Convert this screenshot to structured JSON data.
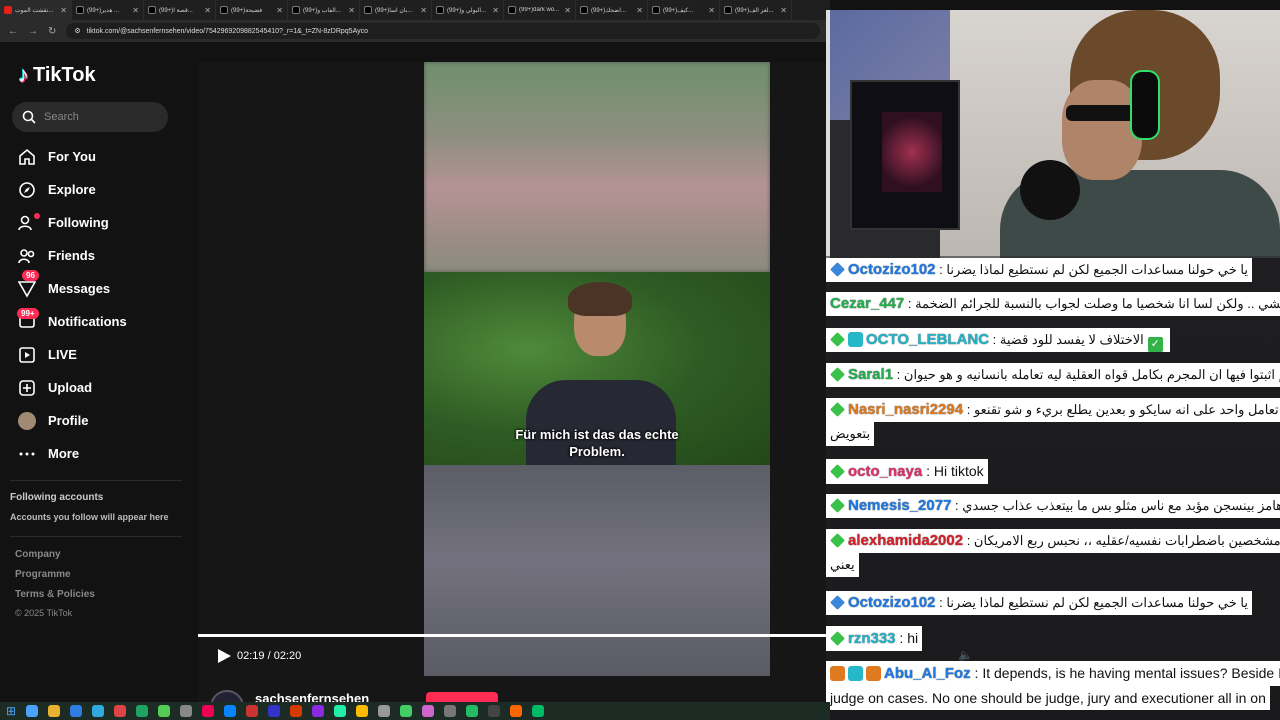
{
  "browser": {
    "tabs": [
      {
        "label": "نقشت الموت...",
        "fav": "youtube-icon",
        "active": true
      },
      {
        "label": "(99+)هدير ...",
        "fav": "tiktok-icon"
      },
      {
        "label": "(99+)قصة ا...",
        "fav": "tiktok-icon"
      },
      {
        "label": "(99+)فضيحة",
        "fav": "tiktok-icon"
      },
      {
        "label": "(99+)الفاب و...",
        "fav": "tiktok-icon"
      },
      {
        "label": "(99+)بان اسا...",
        "fav": "tiktok-icon"
      },
      {
        "label": "(99+)البولي و...",
        "fav": "tiktok-icon"
      },
      {
        "label": "(99+)dark wo...",
        "fav": "tiktok-icon"
      },
      {
        "label": "(99+)اضحك...",
        "fav": "tiktok-icon"
      },
      {
        "label": "(99+)كيف...",
        "fav": "tiktok-icon"
      },
      {
        "label": "(99+)لغز الف...",
        "fav": "tiktok-icon"
      }
    ],
    "url": "tiktok.com/@sachsenfernsehen/video/7542969209882545410?_r=1&_t=ZN-8zDRpq5Ayco"
  },
  "sidebar": {
    "logo": "TikTok",
    "search_placeholder": "Search",
    "nav": [
      {
        "label": "For You",
        "icon": "home-icon"
      },
      {
        "label": "Explore",
        "icon": "compass-icon"
      },
      {
        "label": "Following",
        "icon": "following-icon",
        "dot": true
      },
      {
        "label": "Friends",
        "icon": "friends-icon"
      },
      {
        "label": "Messages",
        "icon": "messages-icon",
        "badge": "96"
      },
      {
        "label": "Notifications",
        "icon": "notifications-icon",
        "badge": "99+"
      },
      {
        "label": "LIVE",
        "icon": "live-icon"
      },
      {
        "label": "Upload",
        "icon": "upload-icon"
      },
      {
        "label": "Profile",
        "icon": "profile-avatar"
      },
      {
        "label": "More",
        "icon": "more-icon"
      }
    ],
    "following_accounts_title": "Following accounts",
    "following_accounts_sub": "Accounts you follow will appear here",
    "footer_links": [
      "Company",
      "Programme",
      "Terms & Policies"
    ],
    "copyright": "© 2025 TikTok"
  },
  "video": {
    "subtitle_line1": "Für mich ist das das echte",
    "subtitle_line2": "Problem.",
    "time": "02:19 / 02:20",
    "progress": 0.993,
    "author": "sachsenfernsehen"
  },
  "chat": [
    {
      "badges": [
        "diamond-blue"
      ],
      "user": "Octozizo102",
      "color": "#1e7be6",
      "text": "يا خي حولنا مساعدات الجميع لكن لم نستطيع لماذا يضرنا",
      "arabic": true
    },
    {
      "badges": [],
      "user": "Cezar_447",
      "color": "#22b14c",
      "text": "معك بهالشي .. ولكن لسا انا شخصيا ما وصلت لجواب بالنسبة للجرائم الضخمة",
      "arabic": true
    },
    {
      "badges": [
        "diamond-green",
        "mod"
      ],
      "user": "OCTO_LEBLANC",
      "color": "#22b5c8",
      "text": "الاختلاف لا يفسد للود قضية",
      "arabic": true,
      "check": true
    },
    {
      "badges": [
        "diamond-green"
      ],
      "user": "Saral1",
      "color": "#22b14c",
      "text": "فيه جرائم اثبتوا فيها ان المجرم بكامل قواه العقلية ليه تعامله بانسانيه و هو حيوان",
      "arabic": true
    },
    {
      "badges": [
        "diamond-green"
      ],
      "user": "Nasri_nasri2294",
      "color": "#e07a20",
      "text": "اتخيل تعامل واحد على انه سايكو و بعدين يطلع بريء و شو تقنعو",
      "text2": "بتعويض",
      "arabic": true
    },
    {
      "badges": [
        "diamond-green"
      ],
      "user": "octo_naya",
      "color": "#e0306a",
      "text": "Hi tiktok",
      "arabic": false
    },
    {
      "badges": [
        "diamond-green"
      ],
      "user": "Nemesis_2077",
      "color": "#1e7be6",
      "text": "هامز بينسجن مؤبد مع ناس مثلو بس ما بيتعذب عذاب جسدي",
      "arabic": true
    },
    {
      "badges": [
        "diamond-green"
      ],
      "user": "alexhamida2002",
      "color": "#d8202a",
      "text": "امريكا مشخصين باضطرابات نفسيه/عقليه ،، نحبس ربع الامريكان",
      "text2": "يعني",
      "arabic": true
    },
    {
      "badges": [
        "diamond-blue"
      ],
      "user": "Octozizo102",
      "color": "#1e7be6",
      "text": "يا خي حولنا مساعدات الجميع لكن لم نستطيع لماذا يضرنا",
      "arabic": true
    },
    {
      "badges": [
        "diamond-green"
      ],
      "user": "rzn333",
      "color": "#22b5c8",
      "text": "hi",
      "arabic": false
    },
    {
      "badges": [
        "gift",
        "mod",
        "gift"
      ],
      "user": "Abu_Al_Foz",
      "color": "#1e7be6",
      "text": "It depends, is he having mental issues? Beside I",
      "text2": "judge on cases. No one should be judge, jury and executioner all in on",
      "arabic": false
    }
  ],
  "colors": {
    "tiktok_red": "#fe2c55",
    "tiktok_cyan": "#25f4ee"
  }
}
